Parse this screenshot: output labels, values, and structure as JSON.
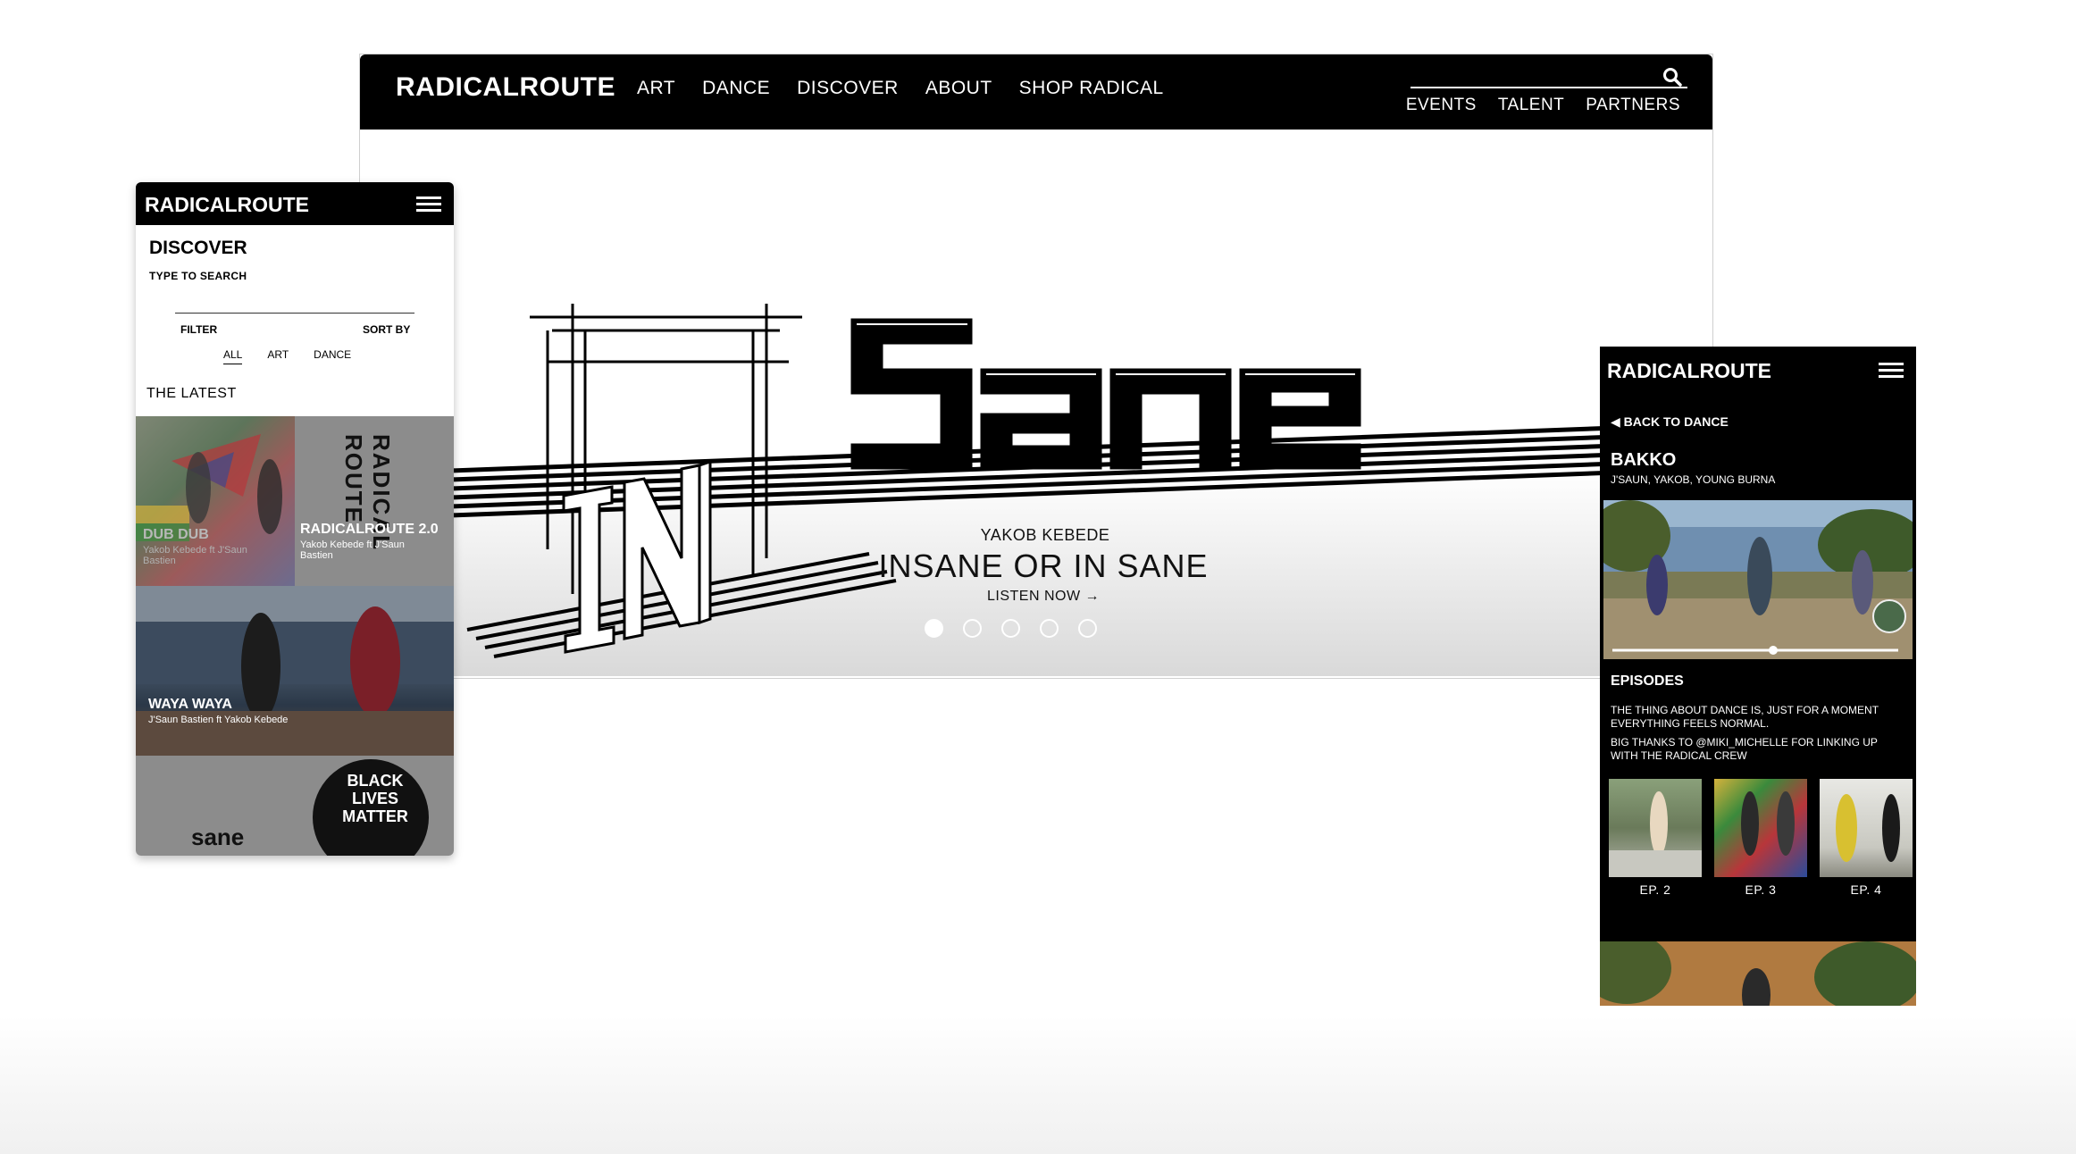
{
  "desktop": {
    "logo": "RADICALROUTE",
    "nav": [
      "ART",
      "DANCE",
      "DISCOVER",
      "ABOUT",
      "SHOP RADICAL"
    ],
    "subnav": [
      "EVENTS",
      "TALENT",
      "PARTNERS"
    ],
    "hero": {
      "artist": "YAKOB KEBEDE",
      "title": "INSANE OR IN SANE",
      "cta": "LISTEN NOW →",
      "slides": 5,
      "active_slide": 1
    }
  },
  "mobile_left": {
    "logo": "RADICALROUTE",
    "heading": "DISCOVER",
    "search_label": "TYPE TO SEARCH",
    "filter": "FILTER",
    "sort": "SORT BY",
    "tabs": [
      "ALL",
      "ART",
      "DANCE"
    ],
    "latest": "THE LATEST",
    "tiles": [
      {
        "title": "DUB DUB",
        "sub": "Yakob Kebede ft J'Saun Bastien"
      },
      {
        "title": "RADICALROUTE 2.0",
        "sub": "Yakob Kebede ft J'Saun Bastien"
      },
      {
        "title": "WAYA WAYA",
        "sub": "J'Saun Bastien ft Yakob Kebede"
      }
    ],
    "art_text": "RADICAL ROUTE",
    "blm_text": [
      "BLACK",
      "LIVES",
      "MATTER"
    ],
    "sane_text": "sane"
  },
  "mobile_right": {
    "logo": "RADICALROUTE",
    "back": "◀ BACK TO DANCE",
    "title": "BAKKO",
    "cast": "J'SAUN, YAKOB, YOUNG BURNA",
    "episodes_heading": "EPISODES",
    "p1": "THE THING ABOUT DANCE IS, JUST FOR A MOMENT EVERYTHING FEELS NORMAL.",
    "p2": "BIG THANKS TO @MIKI_MICHELLE FOR LINKING UP WITH THE RADICAL CREW",
    "episodes": [
      "EP. 2",
      "EP. 3",
      "EP. 4"
    ]
  },
  "colors": {
    "bar": "#000000",
    "accent": "#ffffff",
    "tile_gray": "#8a8a8a"
  }
}
